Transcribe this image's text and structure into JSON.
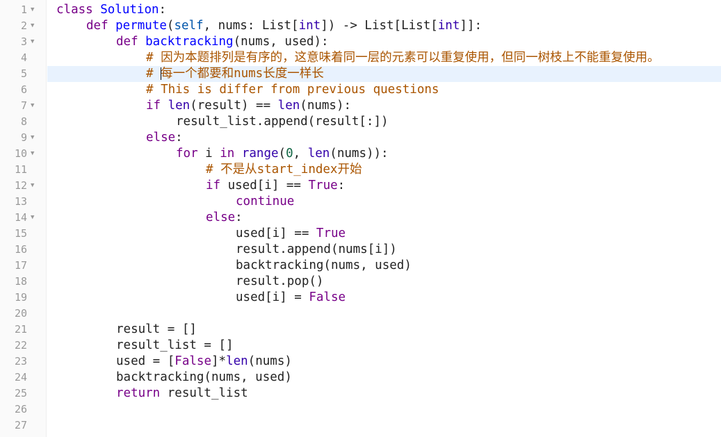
{
  "editor": {
    "lines": [
      {
        "n": "1",
        "fold": true,
        "indent": 0,
        "tokens": [
          [
            "kw",
            "class"
          ],
          [
            "",
            ""
          ],
          [
            "def",
            " Solution"
          ],
          [
            "",
            ":"
          ]
        ]
      },
      {
        "n": "2",
        "fold": true,
        "indent": 1,
        "tokens": [
          [
            "kw",
            "def"
          ],
          [
            "def",
            " permute"
          ],
          [
            "",
            "("
          ],
          [
            "var2",
            "self"
          ],
          [
            "",
            ", nums: List["
          ],
          [
            "bi",
            "int"
          ],
          [
            "",
            "]) -> List[List["
          ],
          [
            "bi",
            "int"
          ],
          [
            "",
            "]]:"
          ]
        ]
      },
      {
        "n": "3",
        "fold": true,
        "indent": 2,
        "tokens": [
          [
            "kw",
            "def"
          ],
          [
            "def",
            " backtracking"
          ],
          [
            "",
            "(nums, used):"
          ]
        ]
      },
      {
        "n": "4",
        "fold": false,
        "indent": 3,
        "tokens": [
          [
            "comment",
            "# 因为本题排列是有序的，这意味着同一层的元素可以重复使用，但同一树枝上不能重复使用。"
          ]
        ]
      },
      {
        "n": "5",
        "fold": false,
        "indent": 3,
        "active": true,
        "tokens": [
          [
            "comment",
            "# "
          ],
          [
            "cursor",
            ""
          ],
          [
            "comment",
            "每一个都要和nums长度一样长"
          ]
        ]
      },
      {
        "n": "6",
        "fold": false,
        "indent": 3,
        "tokens": [
          [
            "comment",
            "# This is differ from previous questions"
          ]
        ]
      },
      {
        "n": "7",
        "fold": true,
        "indent": 3,
        "tokens": [
          [
            "kw",
            "if"
          ],
          [
            "bi",
            " len"
          ],
          [
            "",
            "(result) == "
          ],
          [
            "bi",
            "len"
          ],
          [
            "",
            "(nums):"
          ]
        ]
      },
      {
        "n": "8",
        "fold": false,
        "indent": 4,
        "tokens": [
          [
            "",
            "result_list.append(result[:])"
          ]
        ]
      },
      {
        "n": "9",
        "fold": true,
        "indent": 3,
        "tokens": [
          [
            "kw",
            "else"
          ],
          [
            "",
            ":"
          ]
        ]
      },
      {
        "n": "10",
        "fold": true,
        "indent": 4,
        "tokens": [
          [
            "kw",
            "for"
          ],
          [
            "",
            " i "
          ],
          [
            "kw",
            "in"
          ],
          [
            "bi",
            " range"
          ],
          [
            "",
            "("
          ],
          [
            "num",
            "0"
          ],
          [
            "",
            ", "
          ],
          [
            "bi",
            "len"
          ],
          [
            "",
            "(nums)):"
          ]
        ]
      },
      {
        "n": "11",
        "fold": false,
        "indent": 5,
        "tokens": [
          [
            "comment",
            "# 不是从start_index开始"
          ]
        ]
      },
      {
        "n": "12",
        "fold": true,
        "indent": 5,
        "tokens": [
          [
            "kw",
            "if"
          ],
          [
            "",
            " used[i] == "
          ],
          [
            "kw",
            "True"
          ],
          [
            "",
            ":"
          ]
        ]
      },
      {
        "n": "13",
        "fold": false,
        "indent": 6,
        "tokens": [
          [
            "kw",
            "continue"
          ]
        ]
      },
      {
        "n": "14",
        "fold": true,
        "indent": 5,
        "tokens": [
          [
            "kw",
            "else"
          ],
          [
            "",
            ":"
          ]
        ]
      },
      {
        "n": "15",
        "fold": false,
        "indent": 6,
        "tokens": [
          [
            "",
            "used[i] == "
          ],
          [
            "kw",
            "True"
          ]
        ]
      },
      {
        "n": "16",
        "fold": false,
        "indent": 6,
        "tokens": [
          [
            "",
            "result.append(nums[i])"
          ]
        ]
      },
      {
        "n": "17",
        "fold": false,
        "indent": 6,
        "tokens": [
          [
            "",
            "backtracking(nums, used)"
          ]
        ]
      },
      {
        "n": "18",
        "fold": false,
        "indent": 6,
        "tokens": [
          [
            "",
            "result.pop()"
          ]
        ]
      },
      {
        "n": "19",
        "fold": false,
        "indent": 6,
        "tokens": [
          [
            "",
            "used[i] = "
          ],
          [
            "kw",
            "False"
          ]
        ]
      },
      {
        "n": "20",
        "fold": false,
        "indent": 0,
        "tokens": []
      },
      {
        "n": "21",
        "fold": false,
        "indent": 2,
        "tokens": [
          [
            "",
            "result = []"
          ]
        ]
      },
      {
        "n": "22",
        "fold": false,
        "indent": 2,
        "tokens": [
          [
            "",
            "result_list = []"
          ]
        ]
      },
      {
        "n": "23",
        "fold": false,
        "indent": 2,
        "tokens": [
          [
            "",
            "used = ["
          ],
          [
            "kw",
            "False"
          ],
          [
            "",
            "]*"
          ],
          [
            "bi",
            "len"
          ],
          [
            "",
            "(nums)"
          ]
        ]
      },
      {
        "n": "24",
        "fold": false,
        "indent": 2,
        "tokens": [
          [
            "",
            "backtracking(nums, used)"
          ]
        ]
      },
      {
        "n": "25",
        "fold": false,
        "indent": 2,
        "tokens": [
          [
            "kw",
            "return"
          ],
          [
            "",
            " result_list"
          ]
        ]
      },
      {
        "n": "26",
        "fold": false,
        "indent": 0,
        "tokens": []
      },
      {
        "n": "27",
        "fold": false,
        "indent": 0,
        "tokens": []
      }
    ]
  }
}
